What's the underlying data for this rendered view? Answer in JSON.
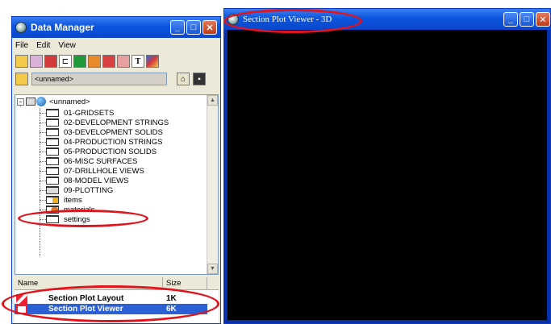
{
  "data_manager": {
    "title": "Data Manager",
    "menu": [
      "File",
      "Edit",
      "View"
    ],
    "path": "<unnamed>",
    "root": "<unnamed>",
    "folders": [
      "01-GRIDSETS",
      "02-DEVELOPMENT STRINGS",
      "03-DEVELOPMENT SOLIDS",
      "04-PRODUCTION STRINGS",
      "05-PRODUCTION SOLIDS",
      "06-MISC SURFACES",
      "07-DRILLHOLE VIEWS",
      "08-MODEL VIEWS",
      "09-PLOTTING"
    ],
    "extra_items": [
      "items",
      "materials",
      "settings"
    ],
    "list_headers": {
      "name": "Name",
      "size": "Size"
    },
    "list_rows": [
      {
        "name": "Section Plot Layout",
        "size": "1K"
      },
      {
        "name": "Section Plot Viewer",
        "size": "6K"
      }
    ]
  },
  "viewer": {
    "title": "Section Plot Viewer - 3D"
  },
  "colors": {
    "title_bar": "#0b55df",
    "highlight_ring": "#e0141c",
    "selection": "#2b5fd6",
    "viewer_bg": "#000000"
  }
}
